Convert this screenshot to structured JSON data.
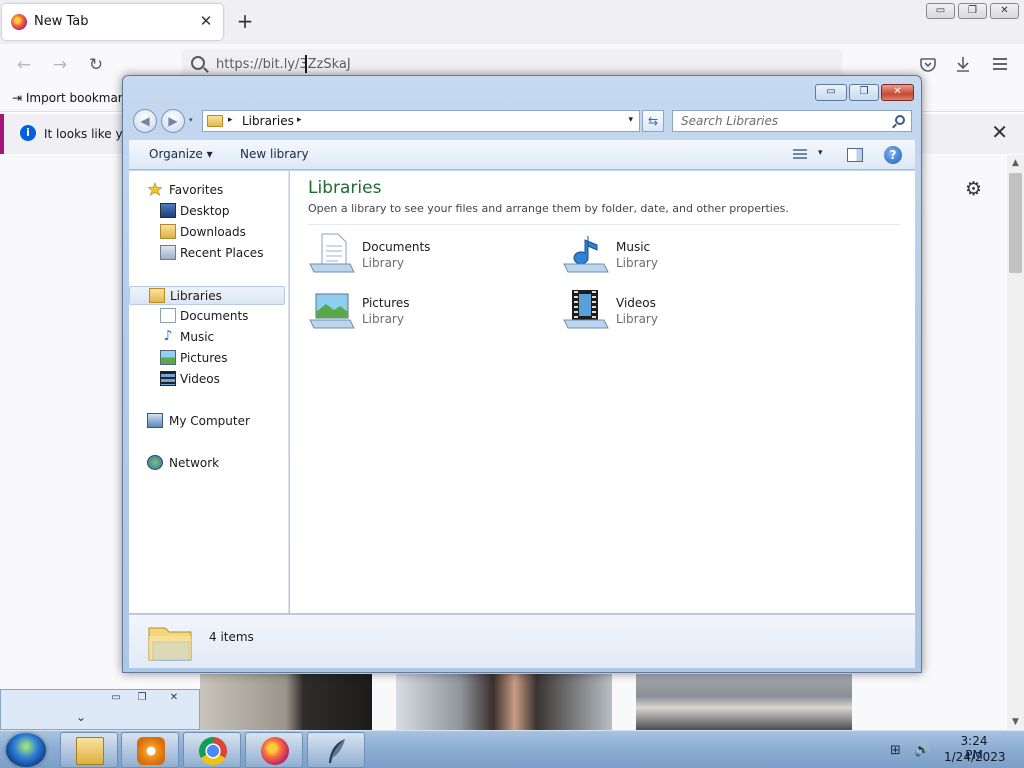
{
  "browser": {
    "tab_title": "New Tab",
    "tab_close": "✕",
    "new_tab": "+",
    "caption": {
      "minimize": "▭",
      "restore": "❐",
      "close": "✕"
    },
    "nav": {
      "back": "←",
      "forward": "→",
      "reload": "↻"
    },
    "url_text": "https://bit.ly/3ZzSkaJ",
    "icons": {
      "pocket": "pocket-icon",
      "downloads": "download-icon",
      "menu": "hamburger-menu-icon"
    },
    "bookmarks_item": "Import bookmarks...",
    "info_text": "It looks like you",
    "info_close": "✕",
    "settings_icon": "⚙"
  },
  "mini_window": {
    "minimize": "▭",
    "restore": "❐",
    "close": "✕",
    "chevron": "⌄"
  },
  "explorer": {
    "caption": {
      "minimize": "▭",
      "maximize": "❐",
      "close": "✕"
    },
    "address": {
      "breadcrumb": "Libraries",
      "sep": "▸",
      "drop": "▾"
    },
    "search_placeholder": "Search Libraries",
    "toolbar": {
      "organize": "Organize ▾",
      "new_library": "New library",
      "views_drop": "▾",
      "help": "?"
    },
    "nav": {
      "favorites": "Favorites",
      "desktop": "Desktop",
      "downloads": "Downloads",
      "recent_places": "Recent Places",
      "libraries": "Libraries",
      "documents": "Documents",
      "music": "Music",
      "pictures": "Pictures",
      "videos": "Videos",
      "my_computer": "My Computer",
      "network": "Network"
    },
    "main": {
      "title": "Libraries",
      "description": "Open a library to see your files and arrange them by folder, date, and other properties.",
      "libraries": [
        {
          "name": "Documents",
          "type": "Library"
        },
        {
          "name": "Music",
          "type": "Library"
        },
        {
          "name": "Pictures",
          "type": "Library"
        },
        {
          "name": "Videos",
          "type": "Library"
        }
      ]
    },
    "details": {
      "count": "4 items"
    }
  },
  "taskbar": {
    "time": "3:24 PM",
    "date": "1/24/2023",
    "apps": [
      "windows-explorer-icon",
      "media-player-icon",
      "chrome-icon",
      "firefox-icon",
      "feather-app-icon"
    ]
  },
  "colors": {
    "library_title": "#1e6b30",
    "taskbar": "#8eaed3",
    "firefox_accent": "#a4147a"
  }
}
